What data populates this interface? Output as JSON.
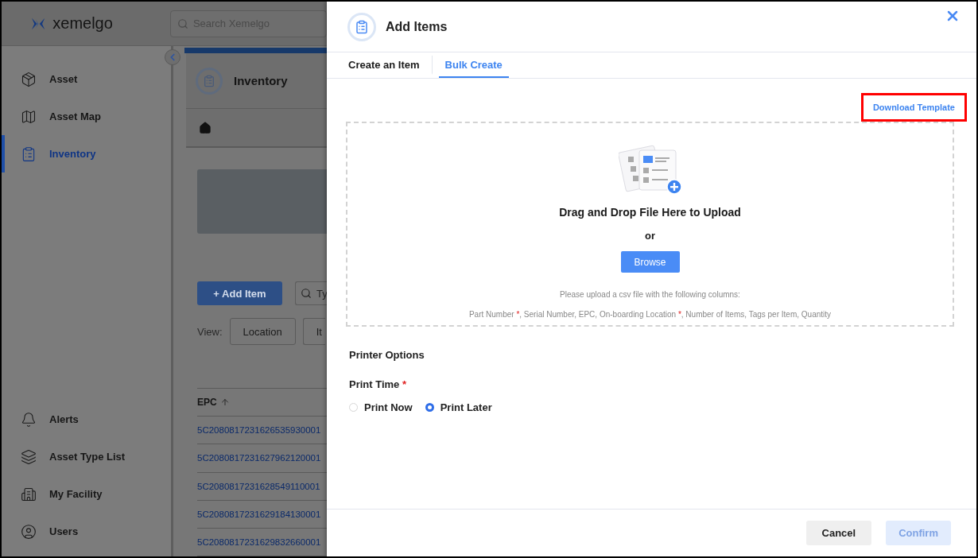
{
  "app": {
    "logo": "xemelgo",
    "search": {
      "placeholder": "Search Xemelgo"
    }
  },
  "sidebar": {
    "items": [
      {
        "label": "Asset",
        "selected": false
      },
      {
        "label": "Asset Map",
        "selected": false
      },
      {
        "label": "Inventory",
        "selected": true
      }
    ],
    "bottom_items": [
      {
        "label": "Alerts",
        "selected": false
      },
      {
        "label": "Asset Type List",
        "selected": false
      },
      {
        "label": "My Facility",
        "selected": false
      },
      {
        "label": "Users",
        "selected": false
      }
    ]
  },
  "page": {
    "title": "Inventory",
    "add_button": "+ Add Item",
    "search": {
      "placeholder": "Ty"
    },
    "view": {
      "label": "View:",
      "options": [
        {
          "label": "Location",
          "selected": false
        },
        {
          "label": "It",
          "selected": false
        }
      ]
    },
    "table": {
      "columns": [
        {
          "label": "EPC",
          "sorted": true
        }
      ],
      "rows": [
        "5C2080817231626535930001",
        "5C2080817231627962120001",
        "5C2080817231628549110001",
        "5C2080817231629184130001",
        "5C2080817231629832660001"
      ]
    }
  },
  "modal": {
    "title": "Add Items",
    "tabs": [
      {
        "label": "Create an Item",
        "selected": false
      },
      {
        "label": "Bulk Create",
        "selected": true
      }
    ],
    "download_template": {
      "label": "Download Template",
      "highlighted": true
    },
    "dropzone": {
      "title": "Drag and Drop File Here to Upload",
      "or": "or",
      "browse_button": "Browse",
      "hint": "Please upload a csv file with the following columns:",
      "required_mark": "*",
      "separator": ", ",
      "columns": [
        {
          "name": "Part Number",
          "required": true
        },
        {
          "name": "Serial Number",
          "required": false
        },
        {
          "name": "EPC",
          "required": false
        },
        {
          "name": "On-boarding Location",
          "required": true
        },
        {
          "name": "Number of Items",
          "required": false
        },
        {
          "name": "Tags per Item",
          "required": false
        },
        {
          "name": "Quantity",
          "required": false
        }
      ]
    },
    "printer_options": {
      "heading": "Printer Options",
      "print_time": {
        "label": "Print Time",
        "required": true,
        "required_mark": "*",
        "options": [
          {
            "label": "Print Now",
            "selected": false
          },
          {
            "label": "Print Later",
            "selected": true
          }
        ]
      }
    },
    "buttons": [
      {
        "label": "Cancel",
        "kind": "secondary",
        "disabled": false
      },
      {
        "label": "Confirm",
        "kind": "primary",
        "disabled": true
      }
    ]
  }
}
